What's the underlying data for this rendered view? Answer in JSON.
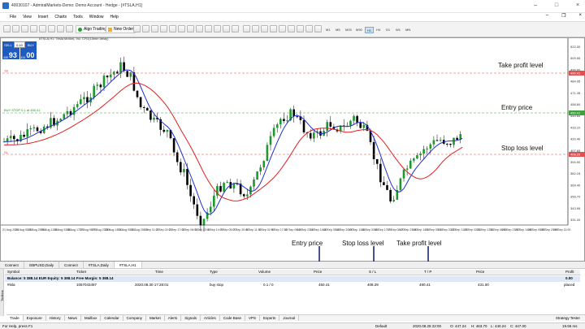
{
  "window": {
    "title": "40030107 - AdmiralMarkets-Demo: Demo Account - Hedge - [#TSLA,H1]"
  },
  "menu": [
    "File",
    "View",
    "Insert",
    "Charts",
    "Tools",
    "Window",
    "Help"
  ],
  "toolbar": {
    "algo_trading": "Algo Trading",
    "new_order": "New Order",
    "timeframes": [
      "M1",
      "M5",
      "M15",
      "M30",
      "H1",
      "H4",
      "D1",
      "W1",
      "MN"
    ],
    "selected_timeframe": "H1"
  },
  "chart": {
    "symbol_line": "#TSLA,H1: Tesla Motors, Inc. CFD(15min delay)",
    "ticket": {
      "sell_label": "SELL",
      "buy_label": "BUY",
      "lot": "0.10",
      "sell_small": "439",
      "sell_big": "93",
      "buy_small": "431",
      "buy_big": "00"
    },
    "tp_line_label": "TP",
    "entry_line_label": "BUY STOP 0.1 at 450.41",
    "sl_line_label": "SL",
    "price_axis": [
      "522.30",
      "509.55",
      "496.80",
      "484.05",
      "471.35",
      "458.60",
      "445.85",
      "433.10",
      "420.40",
      "407.65",
      "394.90",
      "382.15",
      "369.40",
      "356.70",
      "343.95",
      "331.20"
    ],
    "highlighted_prices": [
      "490.41",
      "450.41",
      "408.29"
    ],
    "time_axis": [
      "21 Aug 2020",
      "24 Aug 05:00",
      "24 Aug 20:00",
      "25 Aug 11:00",
      "26 Aug 02:00",
      "26 Aug 17:00",
      "27 Aug 08:00",
      "27 Aug 23:00",
      "28 Aug 14:00",
      "31 Aug 05:00",
      "31 Aug 20:00",
      "1 Sep 11:00",
      "2 Sep 02:00",
      "2 Sep 17:00",
      "3 Sep 08:00",
      "3 Sep 23:00",
      "4 Sep 14:00",
      "7 Sep 05:00",
      "7 Sep 20:00",
      "8 Sep 11:00",
      "9 Sep 02:00",
      "9 Sep 17:00",
      "10 Sep 08:00",
      "10 Sep 23:00",
      "11 Sep 14:00",
      "14 Sep 05:00",
      "14 Sep 20:00",
      "15 Sep 11:00",
      "16 Sep 02:00",
      "16 Sep 17:00",
      "17 Sep 08:00",
      "17 Sep 23:00",
      "18 Sep 14:00",
      "21 Sep 05:00",
      "21 Sep 20:00",
      "22 Sep 11:00",
      "23 Sep 02:00",
      "23 Sep 17:00",
      "24 Sep 08:00",
      "24 Sep 23:00",
      "25 Sep 14:00",
      "28 Sep 05:00",
      "28 Sep 20:00",
      "29 Sep 11:00"
    ]
  },
  "annotations": {
    "take_profit_level": "Take profit level",
    "entry_price": "Entry price",
    "stop_loss_level": "Stop loss level",
    "col_entry_price": "Entry price",
    "col_stop_loss": "Stop loss level",
    "col_take_profit": "Take profit level"
  },
  "chart_tabs": [
    "Connect",
    "GBPUSD,Daily",
    "Connect",
    "#TSLA,Daily",
    "#TSLA,H1"
  ],
  "chart_tabs_active": "#TSLA,H1",
  "terminal": {
    "headers": {
      "symbol": "Symbol",
      "ticket": "Ticket",
      "time": "Time",
      "type": "Type",
      "volume": "Volume",
      "price": "Price",
      "sl": "S / L",
      "tp": "T / P",
      "price2": "Price",
      "profit": "Profit"
    },
    "balance": "Balance: 5 388.14 EUR  Equity: 5 388.14  Free Margin: 5 388.14",
    "balance_profit": "0.00",
    "row": {
      "symbol": "#tsla",
      "ticket": "1057043497",
      "time": "2020.08.30 17:28:01",
      "type": "buy stop",
      "volume": "0.1 / 0",
      "price": "450.41",
      "sl": "408.29",
      "tp": "490.41",
      "price2": "431.00",
      "profit": "placed"
    }
  },
  "terminal_tabs": [
    "Trade",
    "Exposure",
    "History",
    "News",
    "Mailbox",
    "Calendar",
    "Company",
    "Market",
    "Alerts",
    "Signals",
    "Articles",
    "Code Base",
    "VPS",
    "Experts",
    "Journal"
  ],
  "terminal_tabs_active": "Trade",
  "terminal_side_label": "Toolbox",
  "strategy_tester": "Strategy Tester",
  "status": {
    "help": "For Help, press F1",
    "profile": "Default",
    "datetime": "2020.08.28 22:00",
    "open": "O: 447.24",
    "high": "H: 463.70",
    "low": "L: 440.24",
    "close": "C: 447.00",
    "traffic": "19.55 ms"
  }
}
